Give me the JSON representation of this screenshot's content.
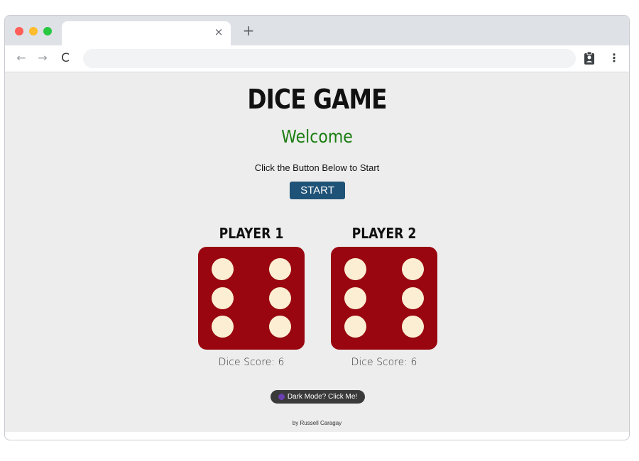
{
  "browser": {
    "tab_close": "×",
    "new_tab": "+",
    "nav_back": "←",
    "nav_forward": "→",
    "nav_reload": "C",
    "menu": "⋮"
  },
  "game": {
    "title": "DICE GAME",
    "welcome": "Welcome",
    "instruction": "Click the Button Below to Start",
    "start_label": "START",
    "players": [
      {
        "name": "PLAYER 1",
        "score_label": "Dice Score: 6",
        "dice_value": 6
      },
      {
        "name": "PLAYER 2",
        "score_label": "Dice Score: 6",
        "dice_value": 6
      }
    ],
    "dark_mode_label": "Dark Mode? Click Me!",
    "footer": "by Russell Caragay"
  },
  "colors": {
    "die": "#99060f",
    "pip": "#fbeed3",
    "welcome": "#1a7d10",
    "start_button": "#1f5277"
  }
}
